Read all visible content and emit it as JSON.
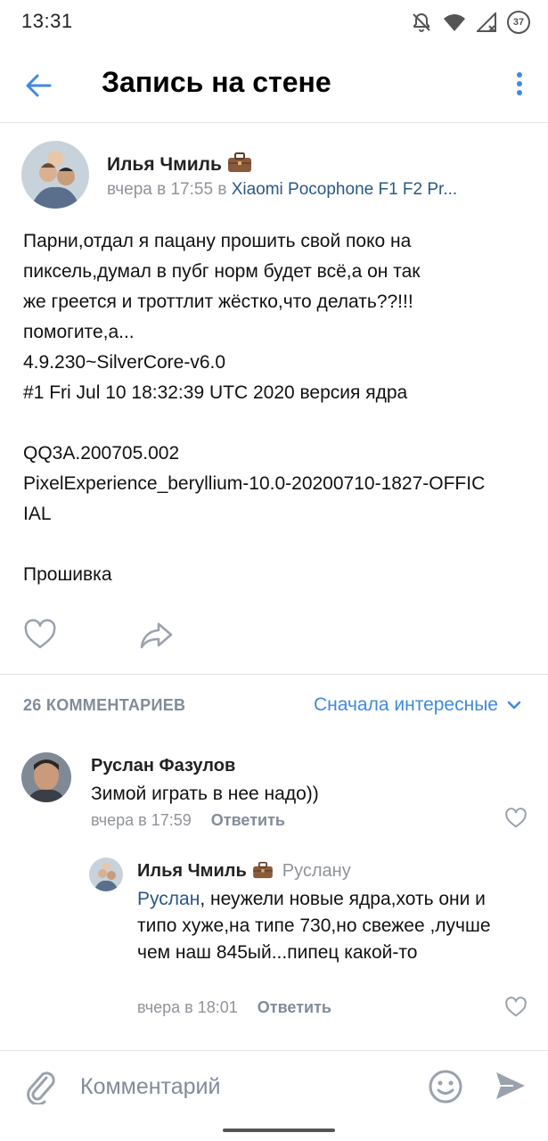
{
  "status_bar": {
    "time": "13:31",
    "battery": "37",
    "icons": [
      "bell-off-icon",
      "wifi-icon",
      "signal-icon",
      "battery-icon"
    ]
  },
  "header": {
    "title": "Запись на стене",
    "back_icon": "arrow-left-icon",
    "menu_icon": "more-vertical-icon"
  },
  "post": {
    "author": "Илья Чмиль",
    "author_badge": "briefcase-icon",
    "time": "вчера в 17:55",
    "via": "в",
    "device": "Xiaomi Pocophone F1 F2 Pr...",
    "text": "Парни,отдал я пацану прошить свой поко на\nпиксель,думал в пубг норм будет всё,а он так\nже греется и троттлит жёстко,что делать??!!!\nпомогите,а...\n4.9.230~SilverCore-v6.0\n#1 Fri Jul 10 18:32:39 UTC 2020 версия ядра\n\nQQ3A.200705.002\nPixelExperience_beryllium-10.0-20200710-1827-OFFIC\nIAL\n\nПрошивка"
  },
  "comments": {
    "count_label": "26 КОММЕНТАРИЕВ",
    "sort_label": "Сначала интересные",
    "items": [
      {
        "author": "Руслан Фазулов",
        "text": "Зимой играть в нее надо))",
        "time": "вчера в 17:59",
        "reply_label": "Ответить"
      },
      {
        "author": "Илья Чмиль",
        "reply_to": "Руслану",
        "mention": "Руслан",
        "text": ", неужели новые ядра,хоть они и типо хуже,на типе 730,но свежее ,лучше чем наш 845ый...пипец какой-то",
        "time": "вчера в 18:01",
        "reply_label": "Ответить"
      }
    ]
  },
  "input_bar": {
    "placeholder": "Комментарий"
  },
  "colors": {
    "accent": "#3f8ae0",
    "link": "#2a5885",
    "meta": "#909399",
    "icon": "#99a2ad"
  }
}
